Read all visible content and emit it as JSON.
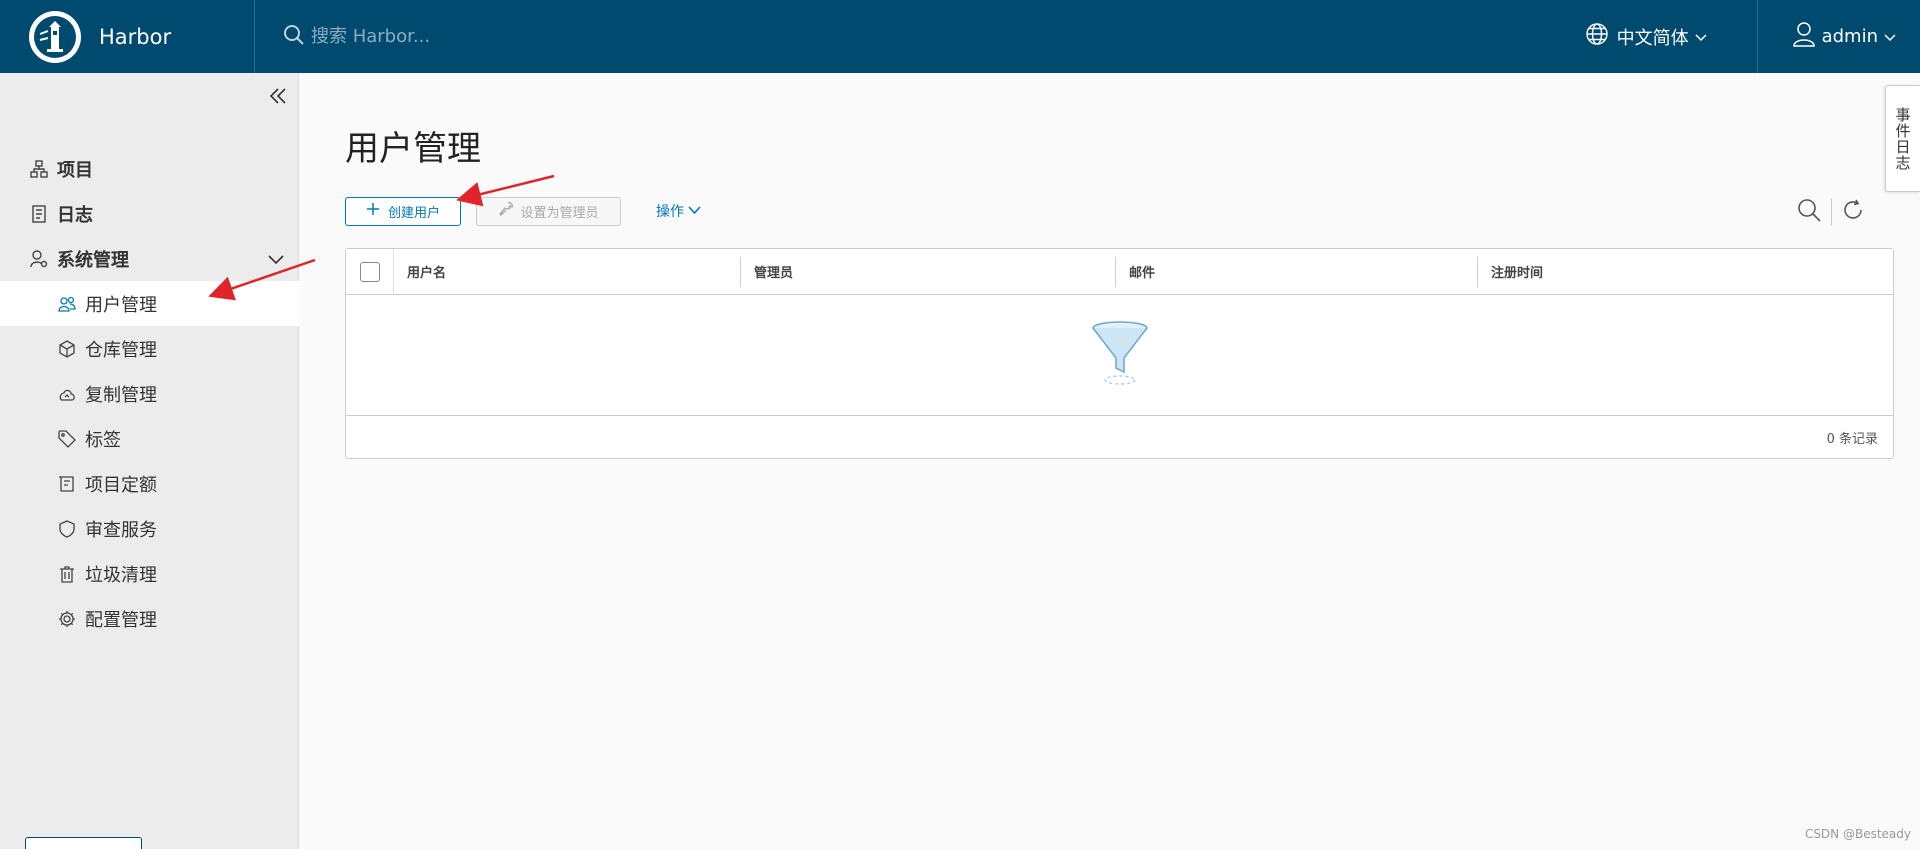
{
  "header": {
    "brand": "Harbor",
    "search_placeholder": "搜索 Harbor...",
    "language": "中文简体",
    "username": "admin"
  },
  "sidebar": {
    "items": [
      {
        "label": "项目",
        "icon": "project-icon"
      },
      {
        "label": "日志",
        "icon": "log-icon"
      },
      {
        "label": "系统管理",
        "icon": "system-admin-icon"
      }
    ],
    "sub_items": [
      {
        "label": "用户管理",
        "icon": "users-icon",
        "active": true
      },
      {
        "label": "仓库管理",
        "icon": "registry-icon"
      },
      {
        "label": "复制管理",
        "icon": "cloud-replication-icon"
      },
      {
        "label": "标签",
        "icon": "tag-icon"
      },
      {
        "label": "项目定额",
        "icon": "quota-icon"
      },
      {
        "label": "审查服务",
        "icon": "shield-icon"
      },
      {
        "label": "垃圾清理",
        "icon": "trash-icon"
      },
      {
        "label": "配置管理",
        "icon": "gear-icon"
      }
    ]
  },
  "main": {
    "title": "用户管理",
    "toolbar": {
      "create_user": "创建用户",
      "set_admin": "设置为管理员",
      "actions": "操作"
    },
    "table": {
      "columns": [
        "用户名",
        "管理员",
        "邮件",
        "注册时间"
      ],
      "rows": [],
      "footer": "0 条记录"
    }
  },
  "events_tab": "事件日志",
  "watermark": "CSDN @Besteady",
  "colors": {
    "header_bg": "#004a70",
    "accent": "#0079b8",
    "sidebar_bg": "#ececec",
    "annotation_arrow": "#e0242a"
  }
}
